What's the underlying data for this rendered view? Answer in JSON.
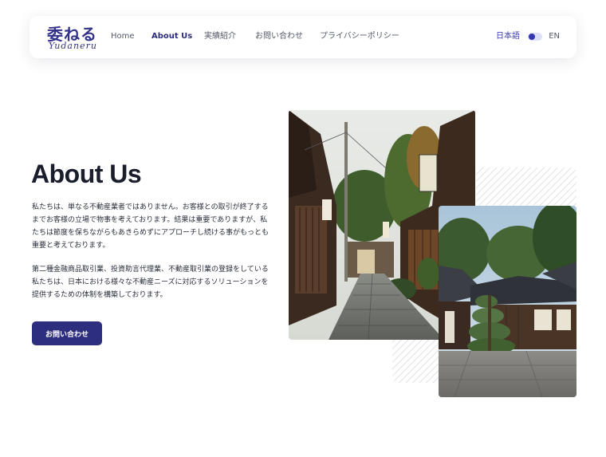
{
  "header": {
    "logo": {
      "main": "委ねる",
      "sub": "Yudaneru"
    },
    "nav": [
      {
        "label": "Home",
        "active": false
      },
      {
        "label": "About Us",
        "active": true
      },
      {
        "label": "実績紹介",
        "active": false
      },
      {
        "label": "お問い合わせ",
        "active": false
      },
      {
        "label": "プライバシーポリシー",
        "active": false
      }
    ],
    "lang": {
      "ja": "日本語",
      "en": "EN",
      "toggle_state": "ja"
    }
  },
  "hero": {
    "title": "About Us",
    "paragraph1": "私たちは、単なる不動産業者ではありません。お客様との取引が終了するまでお客様の立場で物事を考えております。結果は重要でありますが、私たちは節度を保ちながらもあきらめずにアプローチし続ける事がもっとも重要と考えております。",
    "paragraph2": "第二種金融商品取引業、投資助言代理業、不動産取引業の登録をしている私たちは、日本における様々な不動産ニーズに対応するソリューションを提供するための体制を構築しております。",
    "cta_label": "お問い合わせ"
  },
  "images": [
    {
      "icon": "kyoto-alley-photo"
    },
    {
      "icon": "japanese-temple-photo"
    }
  ],
  "colors": {
    "brand": "#2e2e7e",
    "accent": "#3636b0",
    "text": "#1a1e2c"
  }
}
